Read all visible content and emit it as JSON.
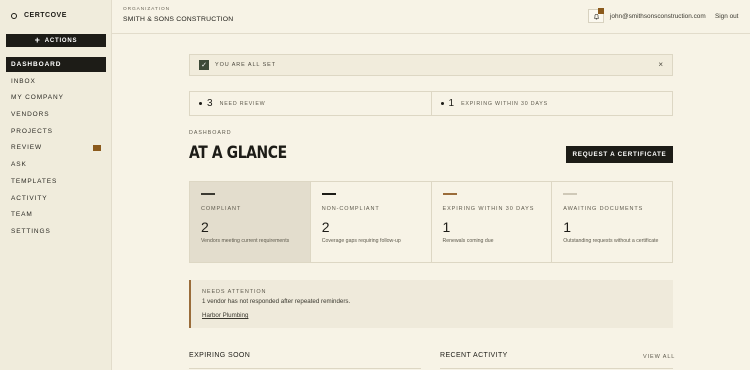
{
  "brand": {
    "name": "CERTCOVE",
    "icon": "circle-logo-icon"
  },
  "sidebar": {
    "actions_label": "ACTIONS",
    "items": [
      {
        "label": "DASHBOARD",
        "active": true
      },
      {
        "label": "INBOX"
      },
      {
        "label": "MY COMPANY"
      },
      {
        "label": "VENDORS"
      },
      {
        "label": "PROJECTS"
      },
      {
        "label": "REVIEW",
        "badge": true
      },
      {
        "label": "ASK"
      },
      {
        "label": "TEMPLATES"
      },
      {
        "label": "ACTIVITY"
      },
      {
        "label": "TEAM"
      },
      {
        "label": "SETTINGS"
      }
    ]
  },
  "header": {
    "org_label": "ORGANIZATION",
    "org_name": "SMITH & SONS CONSTRUCTION",
    "user_email": "john@smithsonsconstruction.com",
    "signout_label": "Sign out"
  },
  "alert": {
    "text": "YOU ARE ALL SET",
    "close": "×"
  },
  "stats": [
    {
      "value": "3",
      "label": "NEED REVIEW"
    },
    {
      "value": "1",
      "label": "EXPIRING WITHIN 30 DAYS"
    }
  ],
  "dashboard": {
    "section_label": "DASHBOARD",
    "title": "AT A GLANCE",
    "request_button": "REQUEST A CERTIFICATE"
  },
  "cards": [
    {
      "label": "COMPLIANT",
      "value": "2",
      "desc": "Vendors meeting current requirements",
      "color": "#3b3a32"
    },
    {
      "label": "NON-COMPLIANT",
      "value": "2",
      "desc": "Coverage gaps requiring follow-up",
      "color": "#1d1c17"
    },
    {
      "label": "EXPIRING WITHIN 30 DAYS",
      "value": "1",
      "desc": "Renewals coming due",
      "color": "#9a6c3a"
    },
    {
      "label": "AWAITING DOCUMENTS",
      "value": "1",
      "desc": "Outstanding requests without a certificate",
      "color": "#cfc9b8"
    }
  ],
  "attention": {
    "label": "NEEDS ATTENTION",
    "text": "1 vendor has not responded after repeated reminders.",
    "link": "Harbor Plumbing"
  },
  "bottom": {
    "expiring_title": "EXPIRING SOON",
    "activity_title": "RECENT ACTIVITY",
    "view_all": "VIEW ALL"
  },
  "colors": {
    "accent": "#8b5a1c",
    "dark": "#1d1c17",
    "background": "#f7f3e6"
  }
}
